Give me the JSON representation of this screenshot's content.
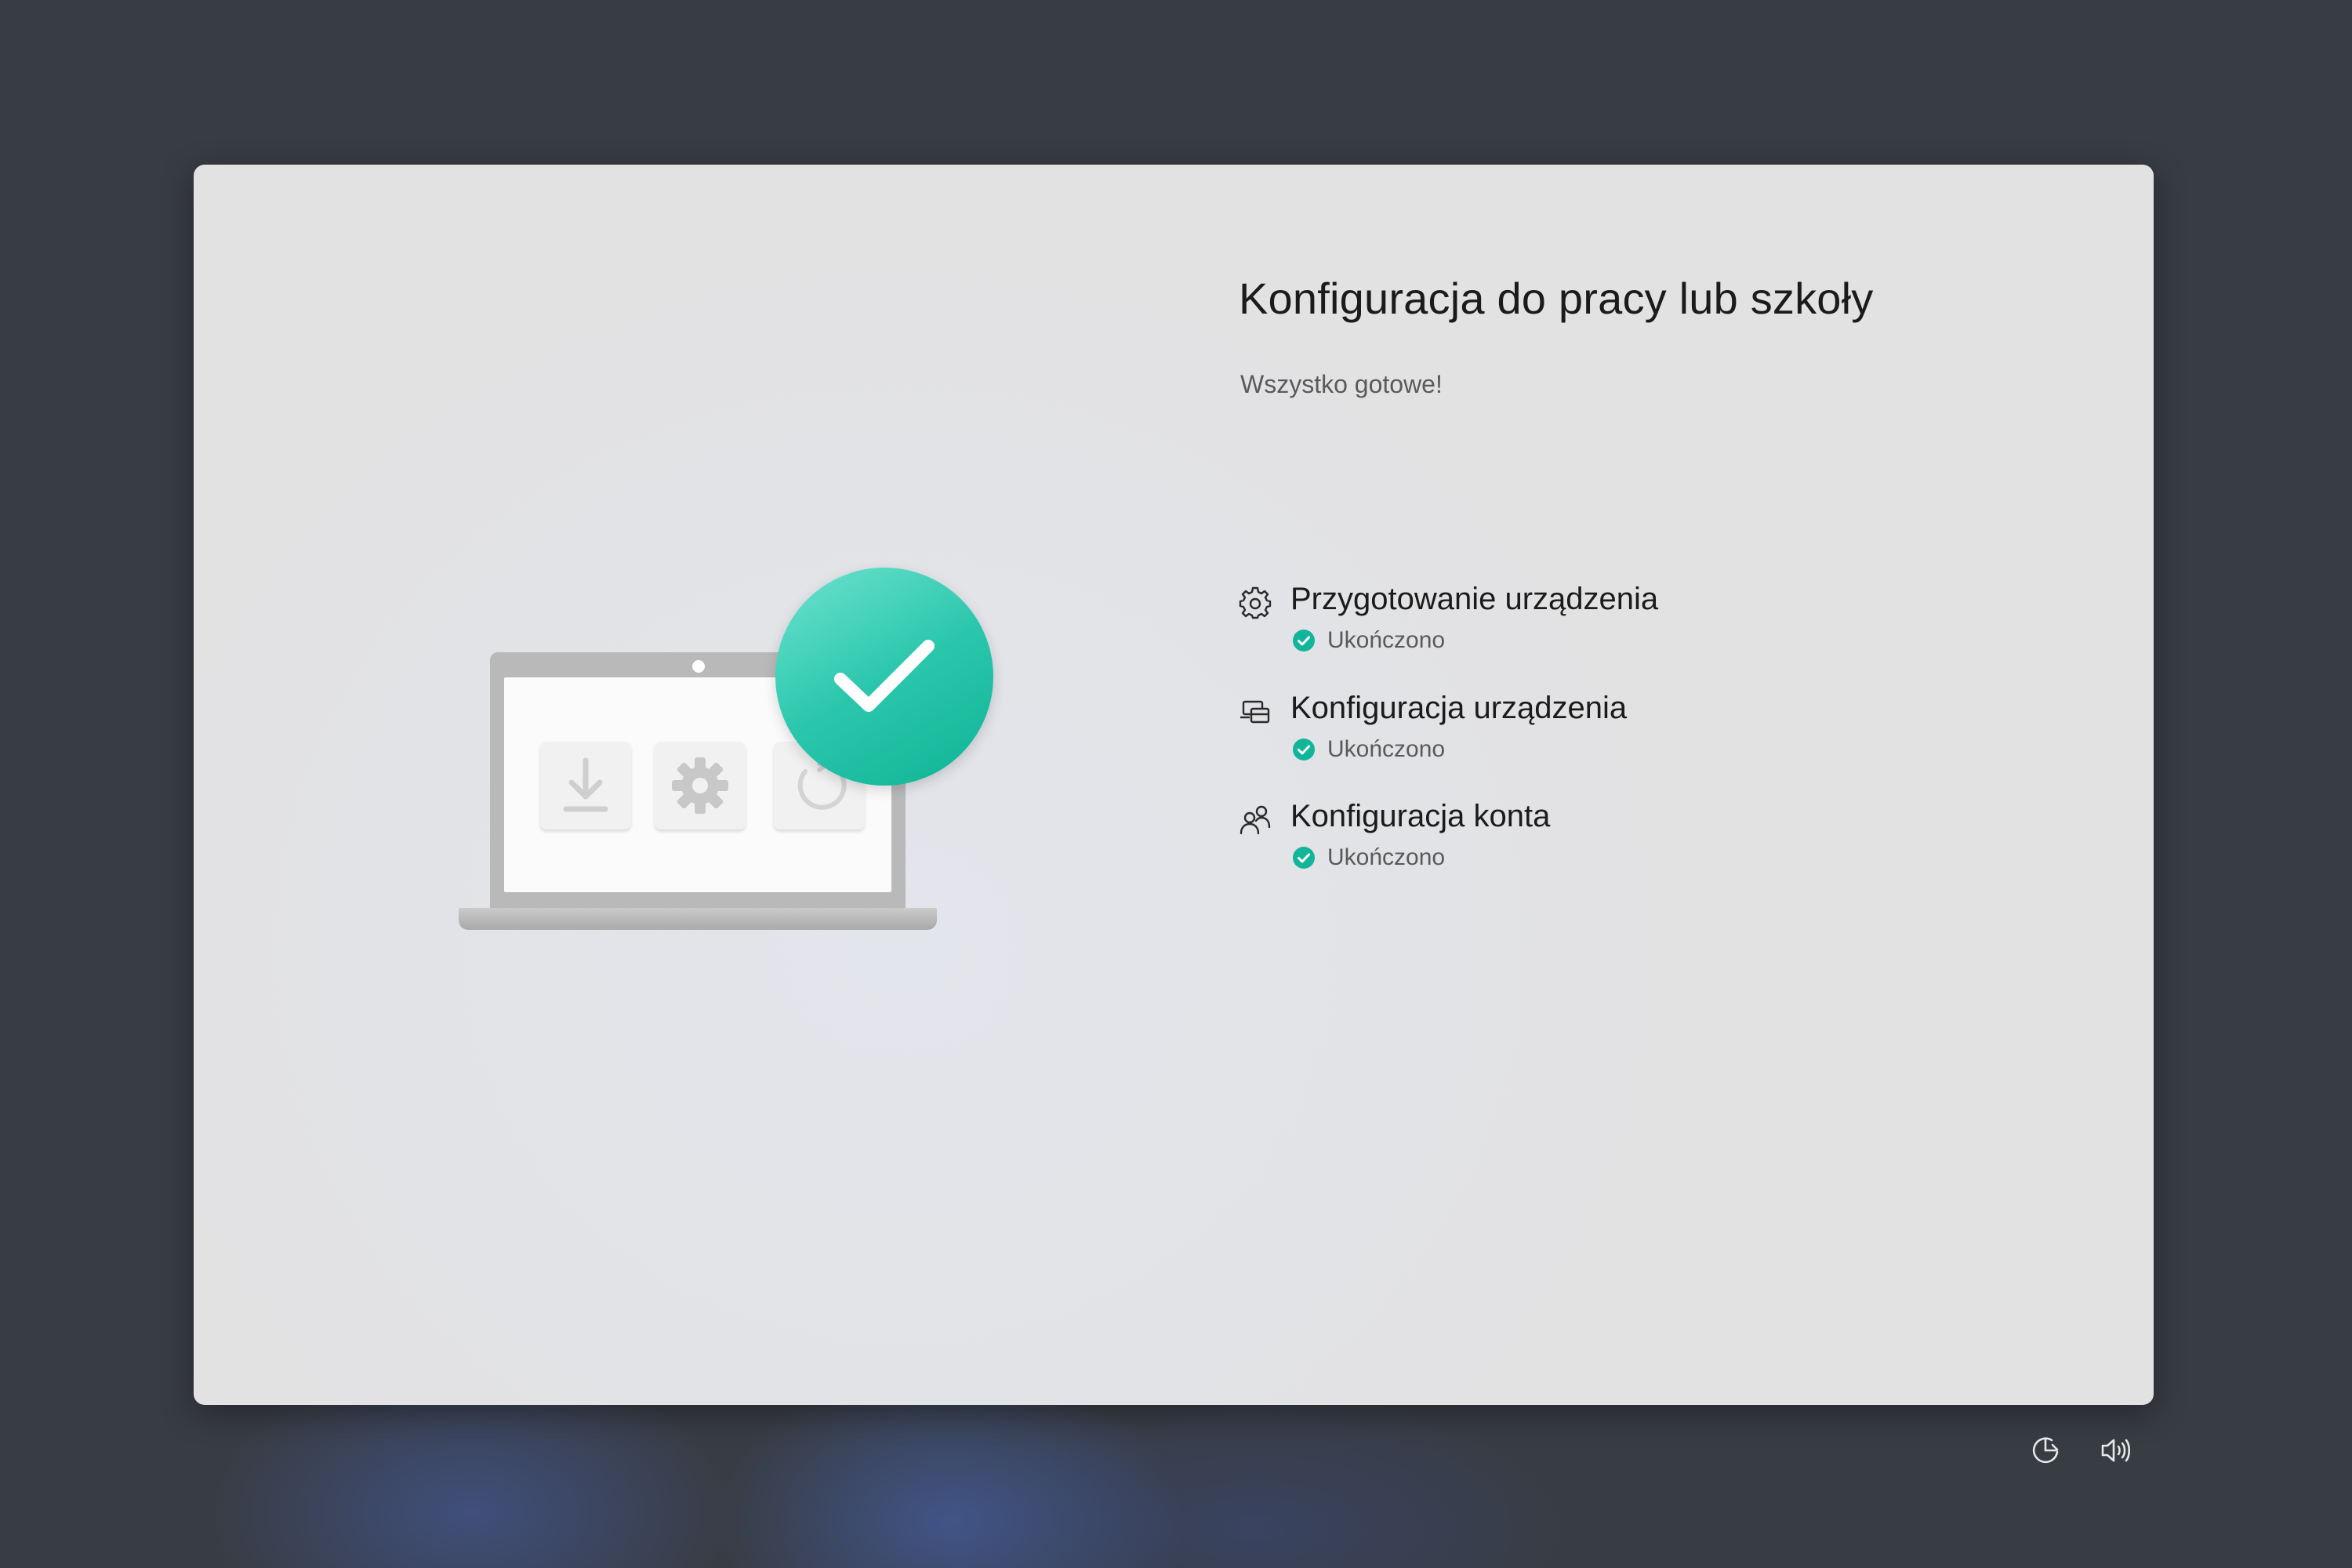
{
  "dialog": {
    "title": "Konfiguracja do pracy lub szkoły",
    "subtitle": "Wszystko gotowe!",
    "steps": [
      {
        "icon": "gear-icon",
        "title": "Przygotowanie urządzenia",
        "status": "Ukończono"
      },
      {
        "icon": "device-setup-icon",
        "title": "Konfiguracja urządzenia",
        "status": "Ukończono"
      },
      {
        "icon": "account-icon",
        "title": "Konfiguracja konta",
        "status": "Ukończono"
      }
    ]
  },
  "illustration": {
    "tiles": [
      "download-icon",
      "gear-icon",
      "refresh-icon"
    ],
    "badge": "checkmark-icon"
  },
  "system_tray": [
    "accessibility-icon",
    "volume-icon"
  ],
  "colors": {
    "accent": "#12b59a",
    "badge_light": "#6fe3d1",
    "dialog_bg": "#e2e2e3",
    "desktop_bg": "#383c43"
  }
}
